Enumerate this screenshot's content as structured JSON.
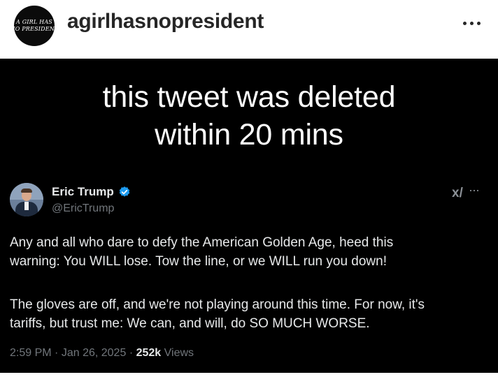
{
  "header": {
    "avatar_line1": "A GIRL HAS",
    "avatar_line2": "NO PRESIDENT",
    "username": "agirlhasnopresident",
    "more_icon": "more-horizontal-icon"
  },
  "post": {
    "headline_line1": "this tweet was deleted",
    "headline_line2": "within 20 mins",
    "tweet": {
      "display_name": "Eric Trump",
      "handle": "@EricTrump",
      "verified_icon": "verified-badge-icon",
      "paragraph1_line1": "Any and all who dare to defy the American Golden Age, heed this",
      "paragraph1_line2": "warning: You WILL lose. Tow the line, or we WILL run you down!",
      "paragraph2_line1": "The gloves are off, and we're not playing around this time. For now, it's",
      "paragraph2_line2": "tariffs, but trust me: We can, and will, do SO MUCH WORSE.",
      "time": "2:59 PM",
      "date": "Jan 26, 2025",
      "views_count": "252k",
      "views_label": "Views",
      "grok_label": "x/",
      "more_label": "···"
    }
  },
  "colors": {
    "background_post": "#000000",
    "text_primary": "#e7e9ea",
    "text_secondary": "#71767b",
    "verified_blue": "#1d9bf0"
  }
}
